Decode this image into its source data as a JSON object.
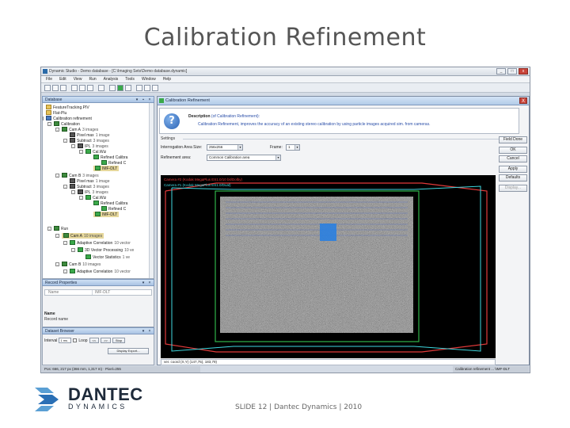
{
  "slide": {
    "title": "Calibration Refinement",
    "footer": "SLIDE 12 | Dantec Dynamics | 2010",
    "logo_name": "DANTEC",
    "logo_sub": "DYNAMICS"
  },
  "app": {
    "title": "Dynamic Studio - Demo database - [C:\\Imaging Sets\\Demo database.dynamic]",
    "window_buttons": [
      "_",
      "□",
      "x"
    ],
    "menu": [
      "File",
      "Edit",
      "View",
      "Run",
      "Analysis",
      "Tools",
      "Window",
      "Help"
    ],
    "colors": {
      "accent": "#3a6fc4",
      "panel_header": "#a9c3e3",
      "close": "#c9443a"
    }
  },
  "database_panel": {
    "title": "Database",
    "tree": [
      {
        "label": "FeatureTracking.PIV",
        "count": "",
        "icon": "folder-icon"
      },
      {
        "label": "Flat-Plu",
        "count": "",
        "icon": "folder-icon"
      },
      {
        "label": "Calibration refinement",
        "count": "",
        "icon": "database-icon"
      },
      {
        "label": "Calibration",
        "count": "",
        "icon": "camera-icon"
      },
      {
        "label": "Cam A",
        "count": "3 images",
        "icon": "camera-icon"
      },
      {
        "label": "Pixel max",
        "count": "1 image",
        "icon": "image-icon"
      },
      {
        "label": "Subtract",
        "count": "3 images",
        "icon": "image-icon"
      },
      {
        "label": "IPL",
        "count": "3 images",
        "icon": "image-icon"
      },
      {
        "label": "Cal.Wiz",
        "count": "",
        "icon": "ensemble-icon"
      },
      {
        "label": "Refined Calibra",
        "count": "",
        "icon": "ensemble-icon"
      },
      {
        "label": "Refined C",
        "count": "",
        "icon": "ensemble-icon"
      },
      {
        "label": "IMF-DLT",
        "count": "",
        "icon": "ensemble-icon"
      },
      {
        "label": "Cam B",
        "count": "3 images",
        "icon": "camera-icon"
      },
      {
        "label": "Pixel max",
        "count": "1 image",
        "icon": "image-icon"
      },
      {
        "label": "Subtract",
        "count": "3 images",
        "icon": "image-icon"
      },
      {
        "label": "IPL",
        "count": "3 images",
        "icon": "image-icon"
      },
      {
        "label": "Cal.Wiz",
        "count": "",
        "icon": "ensemble-icon"
      },
      {
        "label": "Refined Calibra",
        "count": "",
        "icon": "ensemble-icon"
      },
      {
        "label": "Refined C",
        "count": "",
        "icon": "ensemble-icon"
      },
      {
        "label": "IMF-DLT",
        "count": "",
        "icon": "ensemble-icon"
      },
      {
        "label": "Run",
        "count": "",
        "icon": "run-icon"
      },
      {
        "label": "Cam A",
        "count": "10 images",
        "icon": "camera-icon"
      },
      {
        "label": "Adaptive Correlation",
        "count": "10 vector",
        "icon": "ensemble-icon"
      },
      {
        "label": "3D Vector Processing",
        "count": "10 ve",
        "icon": "ensemble-icon"
      },
      {
        "label": "Vector Statistics",
        "count": "1 ve",
        "icon": "ensemble-icon"
      },
      {
        "label": "Cam B",
        "count": "10 images",
        "icon": "camera-icon"
      },
      {
        "label": "Adaptive Correlation",
        "count": "10 vector",
        "icon": "ensemble-icon"
      }
    ]
  },
  "record_properties": {
    "title": "Record Properties",
    "row_key": "Name",
    "row_value": "IMF-DLT",
    "desc_title": "Name",
    "desc_text": "Record name"
  },
  "dataset_browser": {
    "title": "Dataset Browser",
    "interval_label": "Interval",
    "interval_value": "1 ms",
    "loop_label": "Loop",
    "prev_label": "<<",
    "next_label": ">>",
    "stop_label": "Stop",
    "export_label": "Display Export..."
  },
  "status": {
    "left": "Pos: 666, 217 px (366 mm, 1,317 m) · Pixel=255",
    "right": "Calibration refinement ... \\IMF-DLT"
  },
  "dialog": {
    "title": "Calibration Refinement",
    "close_label": "X",
    "description_label": "Description",
    "description_ref": "(of Calibration Refinement):",
    "description_text": "Calibration Refinement, improves the accuracy of an existing stereo calibration by using particle images acquired sim. from cameras.",
    "settings_title": "Settings",
    "interrogation_label": "Interrogation Area Size:",
    "interrogation_value": "256x256",
    "frame_label": "Frame:",
    "frame_value": "1",
    "refinement_label": "Refinement area:",
    "refinement_value": "Common Calibration area",
    "buttons": [
      "Field Done",
      "OK",
      "Cancel",
      "Apply",
      "Defaults",
      "Display..."
    ],
    "overlay_line1": "Camera #2 (Kodak MegaPlus ES1.0/10 bit/Dolby)",
    "overlay_line2": "Camera #1 (Kodak MegaPlus ES1.0/Dual)",
    "coord_text": "ver. coord (X,Y) (147,75), 183,79)",
    "colors": {
      "camera_a": "#e23a3a",
      "camera_b": "#3fd8e0",
      "common_area": "#2fb34a",
      "interrogation": "#2a7fe0"
    }
  }
}
